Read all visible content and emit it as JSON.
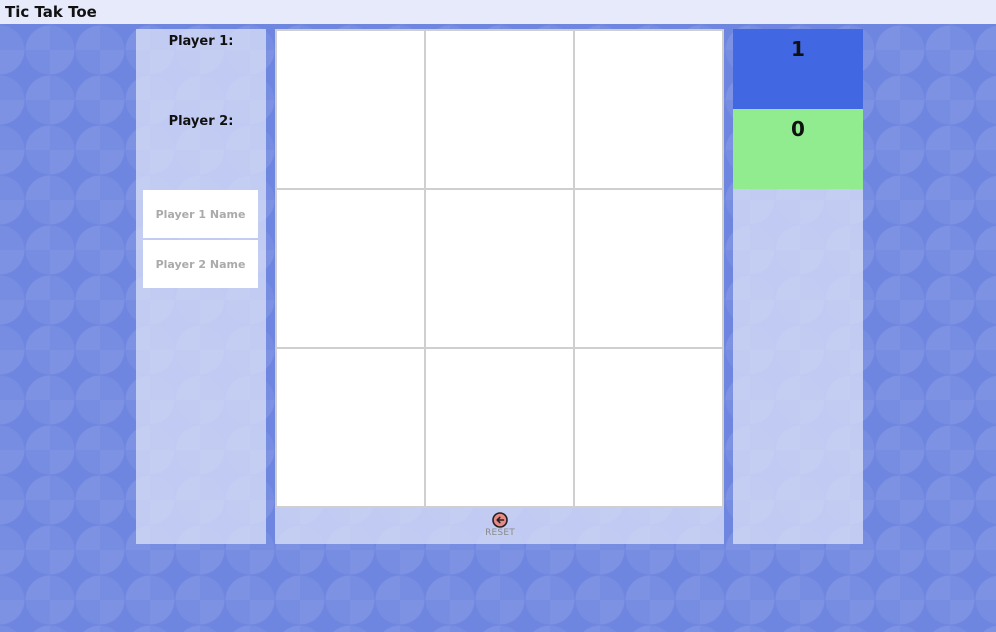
{
  "app": {
    "title": "Tic Tak Toe"
  },
  "players": {
    "p1_label": "Player 1:",
    "p2_label": "Player 2:",
    "p1_name_placeholder": "Player 1 Name",
    "p2_name_placeholder": "Player 2 Name",
    "p1_name_value": "",
    "p2_name_value": ""
  },
  "board": {
    "cells": [
      "",
      "",
      "",
      "",
      "",
      "",
      "",
      "",
      ""
    ]
  },
  "controls": {
    "reset_label": "RESET",
    "reset_icon": "reset-arrow-icon"
  },
  "scores": {
    "p1": "1",
    "p2": "0",
    "p1_color": "#4267e2",
    "p2_color": "#90ec8e"
  },
  "theme": {
    "background": "#6f86e0",
    "panel": "#dfe5fa",
    "topbar": "#e6eafb"
  }
}
